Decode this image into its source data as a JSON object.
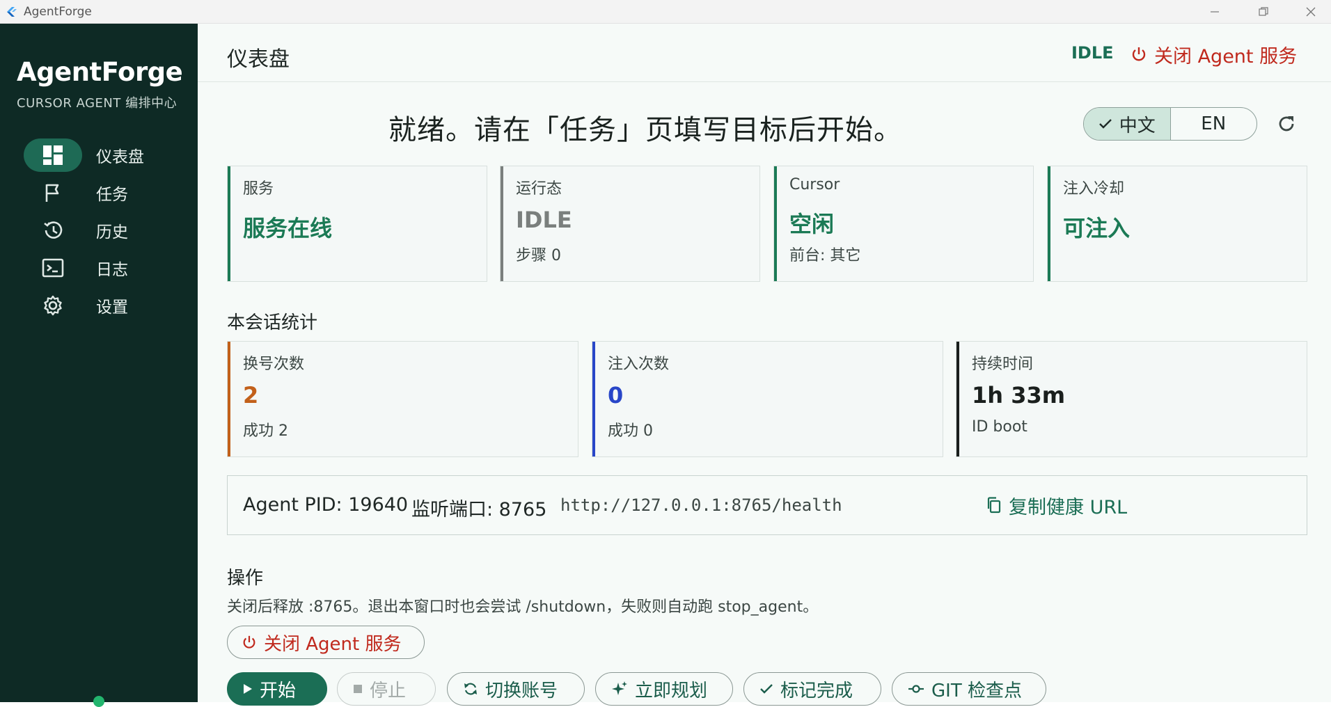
{
  "window": {
    "title": "AgentForge"
  },
  "sidebar": {
    "brand": "AgentForge",
    "subtitle": "CURSOR AGENT 编排中心",
    "items": [
      {
        "label": "仪表盘",
        "icon": "dashboard-icon",
        "active": true
      },
      {
        "label": "任务",
        "icon": "flag-icon",
        "active": false
      },
      {
        "label": "历史",
        "icon": "history-icon",
        "active": false
      },
      {
        "label": "日志",
        "icon": "terminal-icon",
        "active": false
      },
      {
        "label": "设置",
        "icon": "gear-icon",
        "active": false
      }
    ],
    "status_color": "#23b56e"
  },
  "header": {
    "title": "仪表盘",
    "state": "IDLE",
    "close_service": "关闭 Agent 服务"
  },
  "main": {
    "ready_message": "就绪。请在「任务」页填写目标后开始。",
    "language": {
      "options": [
        "中文",
        "EN"
      ],
      "selected": "中文"
    },
    "status_cards": [
      {
        "label": "服务",
        "value": "服务在线",
        "sub": "",
        "accent": "#1b7a55",
        "value_color": "#1b7a55"
      },
      {
        "label": "运行态",
        "value": "IDLE",
        "sub": "步骤 0",
        "accent": "#7a7f7d",
        "value_color": "#7a7f7d"
      },
      {
        "label": "Cursor",
        "value": "空闲",
        "sub": "前台: 其它",
        "accent": "#1b7a55",
        "value_color": "#1b7a55"
      },
      {
        "label": "注入冷却",
        "value": "可注入",
        "sub": "",
        "accent": "#1b7a55",
        "value_color": "#1b7a55"
      }
    ],
    "session_title": "本会话统计",
    "session_cards": [
      {
        "label": "换号次数",
        "value": "2",
        "sub": "成功 2",
        "accent": "#c2601a",
        "value_color": "#c2601a"
      },
      {
        "label": "注入次数",
        "value": "0",
        "sub": "成功 0",
        "accent": "#2846c8",
        "value_color": "#2846c8"
      },
      {
        "label": "持续时间",
        "value": "1h 33m",
        "sub": "ID boot",
        "accent": "#1a1f1d",
        "value_color": "#1a1f1d"
      }
    ],
    "agent": {
      "pid": "Agent PID: 19640",
      "port": "监听端口: 8765",
      "url": "http://127.0.0.1:8765/health",
      "copy_label": "复制健康 URL"
    },
    "ops_title": "操作",
    "ops_desc": "关闭后释放 :8765。退出本窗口时也会尝试 /shutdown，失败则自动跑 stop_agent。",
    "shutdown_label": "关闭 Agent 服务",
    "actions": [
      {
        "label": "开始",
        "icon": "play-icon"
      },
      {
        "label": "停止",
        "icon": "stop-icon"
      },
      {
        "label": "切换账号",
        "icon": "sync-icon"
      },
      {
        "label": "立即规划",
        "icon": "sparkle-icon"
      },
      {
        "label": "标记完成",
        "icon": "check-icon"
      },
      {
        "label": "GIT 检查点",
        "icon": "commit-icon"
      }
    ]
  }
}
